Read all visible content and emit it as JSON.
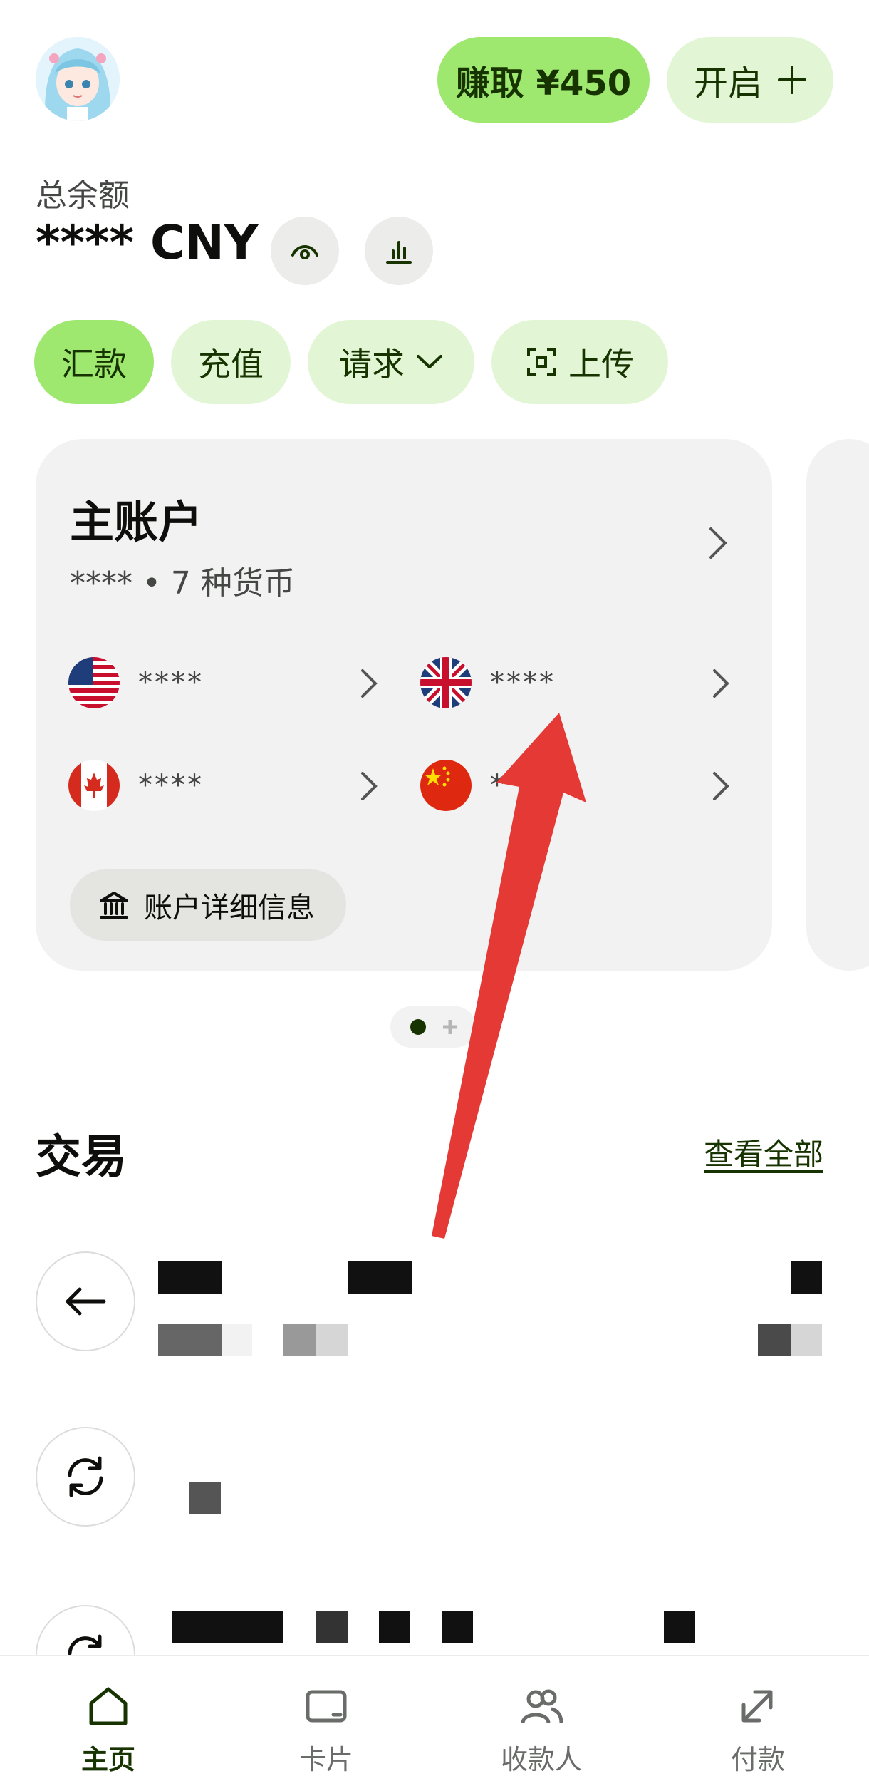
{
  "header": {
    "earn_label": "赚取 ¥450",
    "open_label": "开启",
    "open_icon": "plus-icon"
  },
  "balance": {
    "label": "总余额",
    "value": "**** CNY"
  },
  "actions": [
    {
      "label": "汇款"
    },
    {
      "label": "充值"
    },
    {
      "label": "请求"
    },
    {
      "label": "上传"
    }
  ],
  "account": {
    "title": "主账户",
    "subtitle": "**** • 7 种货币",
    "currencies": [
      {
        "flag": "us-flag-icon",
        "amount": "****"
      },
      {
        "flag": "uk-flag-icon",
        "amount": "****"
      },
      {
        "flag": "ca-flag-icon",
        "amount": "****"
      },
      {
        "flag": "cn-flag-icon",
        "amount": "*"
      }
    ],
    "details_label": "账户详细信息"
  },
  "transactions": {
    "title": "交易",
    "see_all": "查看全部"
  },
  "tabs": [
    {
      "label": "主页",
      "icon": "home-icon",
      "active": true
    },
    {
      "label": "卡片",
      "icon": "card-icon",
      "active": false
    },
    {
      "label": "收款人",
      "icon": "recipients-icon",
      "active": false
    },
    {
      "label": "付款",
      "icon": "payments-icon",
      "active": false
    }
  ],
  "colors": {
    "accent": "#9fe870",
    "accent_light": "#e2f6d5",
    "accent_text": "#163300",
    "annotation": "#e53935"
  }
}
